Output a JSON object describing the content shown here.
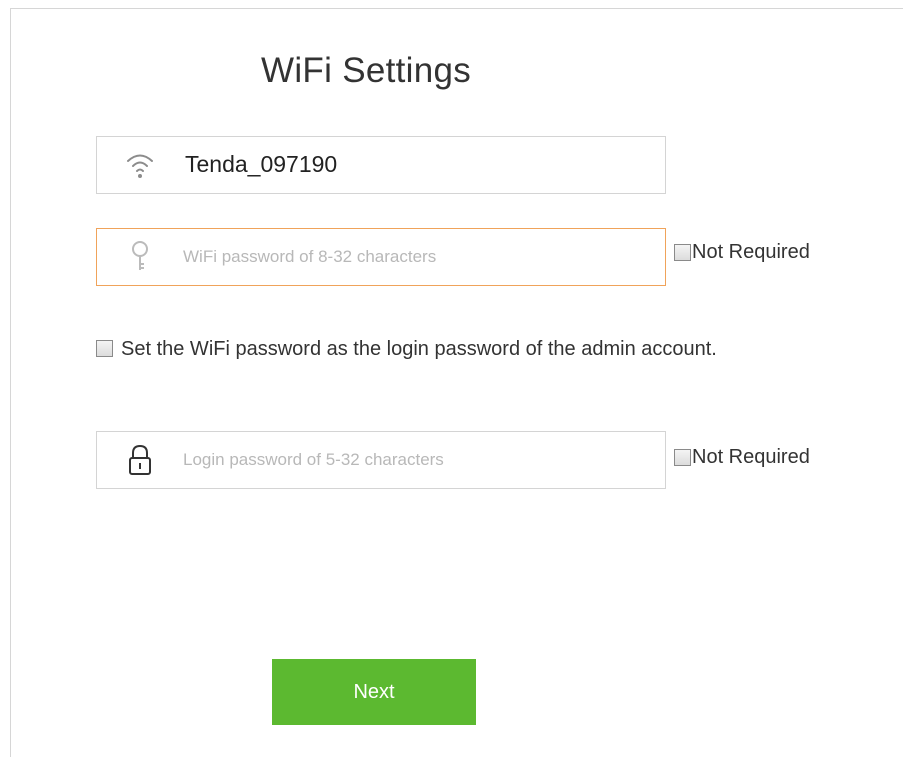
{
  "page": {
    "title": "WiFi Settings"
  },
  "wifi_name": {
    "value": "Tenda_097190",
    "icon": "wifi-icon"
  },
  "wifi_password": {
    "value": "",
    "placeholder": "WiFi password of 8-32 characters",
    "icon": "key-icon",
    "not_required_label": "Not Required",
    "not_required_checked": false
  },
  "sync_option": {
    "label": "Set the WiFi password as the login password of the admin account.",
    "checked": false
  },
  "login_password": {
    "value": "",
    "placeholder": "Login password of 5-32 characters",
    "icon": "lock-icon",
    "not_required_label": "Not Required",
    "not_required_checked": false
  },
  "actions": {
    "next_label": "Next"
  },
  "colors": {
    "accent_green": "#5cb930",
    "focus_border": "#f0a35a"
  }
}
